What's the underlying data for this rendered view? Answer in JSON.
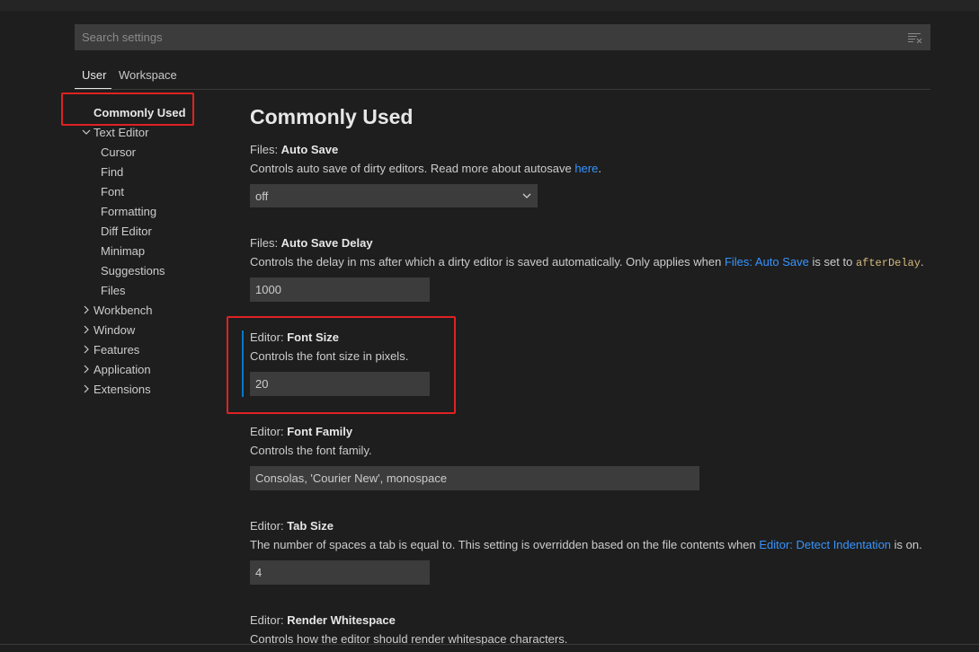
{
  "search": {
    "placeholder": "Search settings"
  },
  "tabs": [
    "User",
    "Workspace"
  ],
  "toc": {
    "commonly_used": "Commonly Used",
    "text_editor": "Text Editor",
    "text_editor_children": [
      "Cursor",
      "Find",
      "Font",
      "Formatting",
      "Diff Editor",
      "Minimap",
      "Suggestions",
      "Files"
    ],
    "workbench": "Workbench",
    "window": "Window",
    "features": "Features",
    "application": "Application",
    "extensions": "Extensions"
  },
  "main": {
    "heading": "Commonly Used",
    "auto_save": {
      "category": "Files: ",
      "name": "Auto Save",
      "desc": "Controls auto save of dirty editors. Read more about autosave ",
      "link": "here",
      "desc_end": ".",
      "value": "off"
    },
    "auto_save_delay": {
      "category": "Files: ",
      "name": "Auto Save Delay",
      "desc": "Controls the delay in ms after which a dirty editor is saved automatically. Only applies when ",
      "link": "Files: Auto Save",
      "desc_mid": " is set to ",
      "code": "afterDelay",
      "desc_end": ".",
      "value": "1000"
    },
    "font_size": {
      "category": "Editor: ",
      "name": "Font Size",
      "desc": "Controls the font size in pixels.",
      "value": "20"
    },
    "font_family": {
      "category": "Editor: ",
      "name": "Font Family",
      "desc": "Controls the font family.",
      "value": "Consolas, 'Courier New', monospace"
    },
    "tab_size": {
      "category": "Editor: ",
      "name": "Tab Size",
      "desc": "The number of spaces a tab is equal to. This setting is overridden based on the file contents when ",
      "link": "Editor: Detect Indentation",
      "desc_end": " is on.",
      "value": "4"
    },
    "render_whitespace": {
      "category": "Editor: ",
      "name": "Render Whitespace",
      "desc": "Controls how the editor should render whitespace characters."
    }
  },
  "colors": {
    "background": "#1e1e1e",
    "input_bg": "#3c3c3c",
    "link": "#3794ff",
    "focus": "#007acc",
    "annotation": "#e02222"
  }
}
